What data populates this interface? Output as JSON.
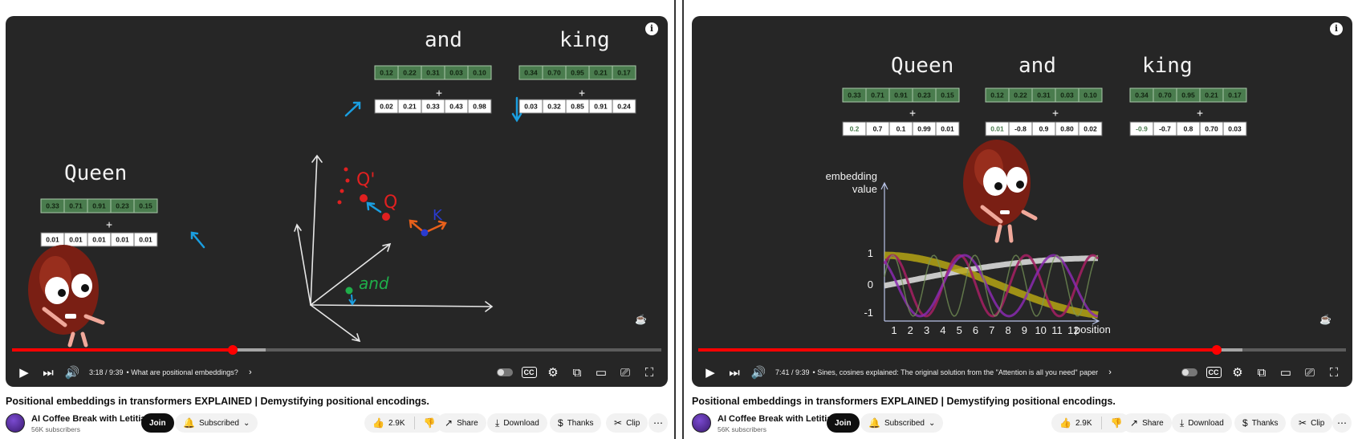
{
  "left": {
    "video": {
      "words": {
        "queen": "Queen",
        "and": "and",
        "king": "king",
        "plus": "+"
      },
      "queen_embed": [
        "0.33",
        "0.71",
        "0.91",
        "0.23",
        "0.15"
      ],
      "queen_pos": [
        "0.01",
        "0.01",
        "0.01",
        "0.01",
        "0.01"
      ],
      "and_embed": [
        "0.12",
        "0.22",
        "0.31",
        "0.03",
        "0.10"
      ],
      "and_pos": [
        "0.02",
        "0.21",
        "0.33",
        "0.43",
        "0.98"
      ],
      "king_embed": [
        "0.34",
        "0.70",
        "0.95",
        "0.21",
        "0.17"
      ],
      "king_pos": [
        "0.03",
        "0.32",
        "0.85",
        "0.91",
        "0.24"
      ],
      "sketch": {
        "q_prime": "Q'",
        "q": "Q",
        "k": "K",
        "and_label": "and"
      },
      "progress_fraction": 0.34,
      "buffer_fraction": 0.39,
      "time": "3:18 / 9:39",
      "chapter": "• What are positional embeddings?"
    },
    "title": "Positional embeddings in transformers EXPLAINED | Demystifying positional encodings.",
    "channel": "AI Coffee Break with Letitia",
    "subscribers": "56K subscribers",
    "join": "Join",
    "subscribed": "Subscribed",
    "likes": "2.9K",
    "share": "Share",
    "download": "Download",
    "thanks": "Thanks",
    "clip": "Clip"
  },
  "right": {
    "video": {
      "words": {
        "queen": "Queen",
        "and": "and",
        "king": "king",
        "plus": "+"
      },
      "queen_embed": [
        "0.33",
        "0.71",
        "0.91",
        "0.23",
        "0.15"
      ],
      "queen_pos": [
        "0.2",
        "0.7",
        "0.1",
        "0.99",
        "0.01"
      ],
      "and_embed": [
        "0.12",
        "0.22",
        "0.31",
        "0.03",
        "0.10"
      ],
      "and_pos": [
        "0.01",
        "-0.8",
        "0.9",
        "0.80",
        "0.02"
      ],
      "king_embed": [
        "0.34",
        "0.70",
        "0.95",
        "0.21",
        "0.17"
      ],
      "king_pos": [
        "-0.9",
        "-0.7",
        "0.8",
        "0.70",
        "0.03"
      ],
      "plot": {
        "ylabel_line1": "embedding",
        "ylabel_line2": "value",
        "xlabel": "position",
        "y_ticks": [
          "1",
          "0",
          "-1"
        ],
        "x_ticks": [
          "1",
          "2",
          "3",
          "4",
          "5",
          "6",
          "7",
          "8",
          "9",
          "10",
          "11",
          "12"
        ]
      },
      "progress_fraction": 0.8,
      "buffer_fraction": 0.84,
      "time": "7:41 / 9:39",
      "chapter": "• Sines, cosines explained: The original solution from the \"Attention is all you need\" paper"
    },
    "title": "Positional embeddings in transformers EXPLAINED | Demystifying positional encodings.",
    "channel": "AI Coffee Break with Letitia",
    "subscribers": "56K subscribers",
    "join": "Join",
    "subscribed": "Subscribed",
    "likes": "2.9K",
    "share": "Share",
    "download": "Download",
    "thanks": "Thanks",
    "clip": "Clip"
  },
  "colors": {
    "progress": "#ff0000",
    "cell_green": "#4a7c4e",
    "sketch_red": "#e02020",
    "sketch_blue": "#1a9ee0",
    "sketch_orange": "#e8601a",
    "sketch_green": "#1fae4a"
  }
}
